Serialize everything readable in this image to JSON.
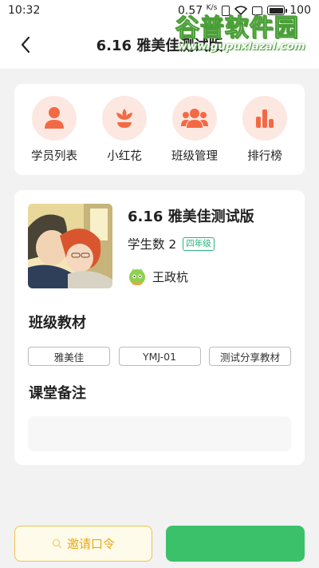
{
  "status_bar": {
    "time": "10:32",
    "speed": "0.57",
    "speed_unit": "K/s",
    "battery": "100"
  },
  "header": {
    "title": "6.16 雅美佳测试版",
    "back_icon": "chevron-left-icon"
  },
  "menu": {
    "items": [
      {
        "label": "学员列表",
        "icon": "user-icon"
      },
      {
        "label": "小红花",
        "icon": "flower-icon"
      },
      {
        "label": "班级管理",
        "icon": "group-icon"
      },
      {
        "label": "排行榜",
        "icon": "bar-chart-icon"
      }
    ],
    "accent_color": "#f26a45",
    "icon_bg_color": "#fde7e1"
  },
  "class_info": {
    "name": "6.16 雅美佳测试版",
    "student_count": "学生数 2",
    "grade": "四年级",
    "teacher": "王政杭"
  },
  "materials": {
    "title": "班级教材",
    "tags": [
      "雅美佳",
      "YMJ-01",
      "测试分享教材"
    ]
  },
  "notes": {
    "title": "课堂备注",
    "value": ""
  },
  "actions": {
    "invite_label": "邀请口令"
  },
  "watermark": {
    "title": "谷普软件园",
    "url": "www.gupuxlazal.com"
  }
}
